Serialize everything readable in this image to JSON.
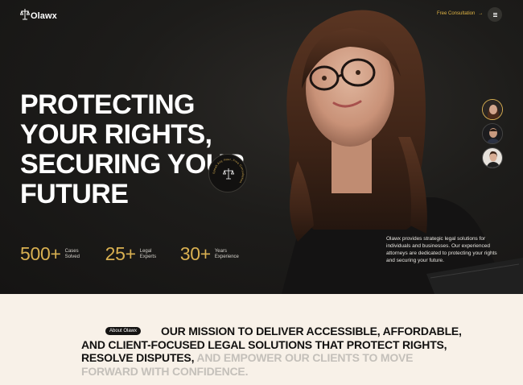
{
  "header": {
    "logo_text": "Olawx",
    "cta_label": "Free Consultation",
    "cta_arrow": "→",
    "menu_icon": "menu-icon"
  },
  "hero": {
    "headline": "PROTECTING YOUR RIGHTS, SECURING YOUR FUTURE",
    "badge_text": "Speak Any Hour, Free Consultation",
    "stats": [
      {
        "value": "500+",
        "label": "Cases Solved"
      },
      {
        "value": "25+",
        "label": "Legal Experts"
      },
      {
        "value": "30+",
        "label": "Years Experience"
      }
    ],
    "description": "Olawx provides strategic legal solutions for individuals and businesses. Our experienced attorneys are dedicated to protecting your rights and securing your future."
  },
  "about": {
    "tag": "About Olawx",
    "mission_dark": "OUR MISSION TO DELIVER ACCESSIBLE, AFFORDABLE, AND CLIENT-FOCUSED LEGAL SOLUTIONS THAT PROTECT RIGHTS, RESOLVE DISPUTES,",
    "mission_muted": " AND EMPOWER OUR CLIENTS TO MOVE FORWARD WITH CONFIDENCE."
  },
  "colors": {
    "accent": "#d9b051",
    "hero_bg": "#1a1918",
    "about_bg": "#f8f1e8"
  }
}
